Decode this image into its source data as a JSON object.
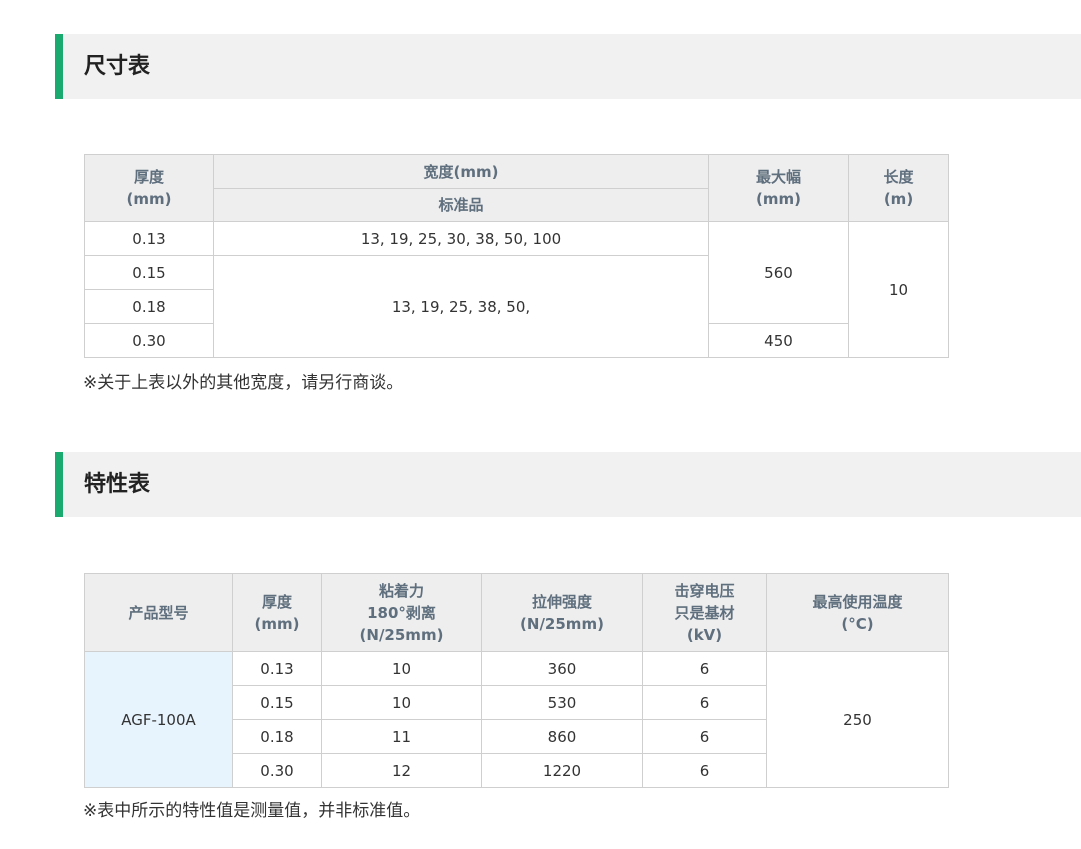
{
  "size_section": {
    "title": "尺寸表",
    "headers": {
      "thickness": "厚度\n(mm)",
      "width": "宽度(mm)",
      "width_sub": "标准品",
      "max_width": "最大幅\n(mm)",
      "length": "长度\n(m)"
    },
    "rows": [
      {
        "thickness": "0.13",
        "widths": "13, 19, 25, 30, 38, 50, 100"
      },
      {
        "thickness": "0.15",
        "widths": "13, 19, 25, 38, 50,"
      },
      {
        "thickness": "0.18"
      },
      {
        "thickness": "0.30"
      }
    ],
    "max_width_a": "560",
    "max_width_b": "450",
    "length": "10",
    "note": "※关于上表以外的其他宽度，请另行商谈。"
  },
  "props_section": {
    "title": "特性表",
    "headers": {
      "model": "产品型号",
      "thickness": "厚度\n(mm)",
      "adhesion": "粘着力\n180°剥离\n(N/25mm)",
      "tensile": "拉伸强度\n(N/25mm)",
      "breakdown": "击穿电压\n只是基材\n(kV)",
      "max_temp": "最高使用温度\n(°C)"
    },
    "model": "AGF-100A",
    "rows": [
      {
        "thickness": "0.13",
        "adhesion": "10",
        "tensile": "360",
        "breakdown": "6"
      },
      {
        "thickness": "0.15",
        "adhesion": "10",
        "tensile": "530",
        "breakdown": "6"
      },
      {
        "thickness": "0.18",
        "adhesion": "11",
        "tensile": "860",
        "breakdown": "6"
      },
      {
        "thickness": "0.30",
        "adhesion": "12",
        "tensile": "1220",
        "breakdown": "6"
      }
    ],
    "max_temp": "250",
    "note": "※表中所示的特性值是测量值，并非标准值。"
  },
  "colors": {
    "accent": "#1aaa6f",
    "header_bg": "#f1f1f1",
    "table_header_bg": "#eeeeee",
    "table_header_text": "#5f6f7e",
    "model_cell_bg": "#e8f4fd"
  }
}
